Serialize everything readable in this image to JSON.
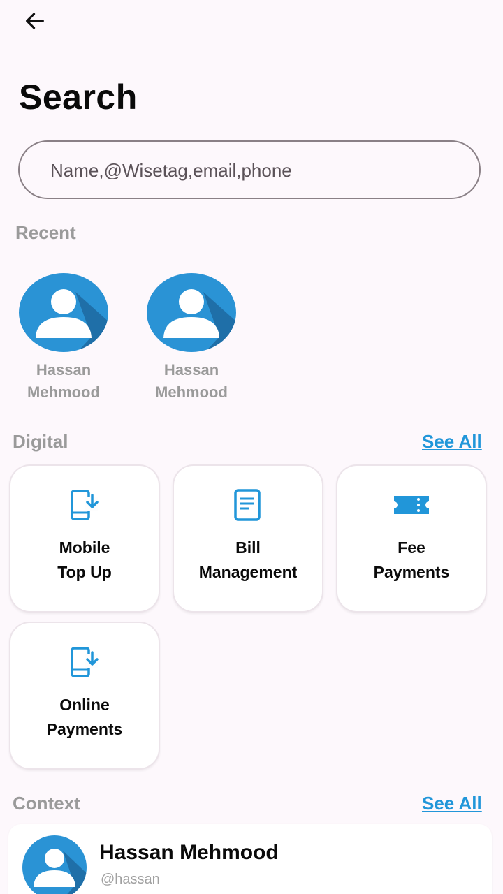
{
  "header": {
    "title": "Search"
  },
  "search": {
    "placeholder": "Name,@Wisetag,email,phone"
  },
  "recent": {
    "label": "Recent",
    "items": [
      {
        "name": "Hassan\nMehmood"
      },
      {
        "name": "Hassan\nMehmood"
      }
    ]
  },
  "digital": {
    "label": "Digital",
    "see_all": "See All",
    "tiles": [
      {
        "label": "Mobile\nTop Up",
        "icon": "mobile-download-icon"
      },
      {
        "label": "Bill\nManagement",
        "icon": "document-icon"
      },
      {
        "label": "Fee\nPayments",
        "icon": "ticket-icon"
      },
      {
        "label": "Online\nPayments",
        "icon": "mobile-download-icon"
      }
    ]
  },
  "context": {
    "label": "Context",
    "see_all": "See All",
    "card": {
      "name": "Hassan Mehmood",
      "handle": "@hassan"
    }
  },
  "colors": {
    "accent": "#2196d9",
    "avatar_bg": "#2a93d5",
    "background": "#fdf8fc"
  }
}
